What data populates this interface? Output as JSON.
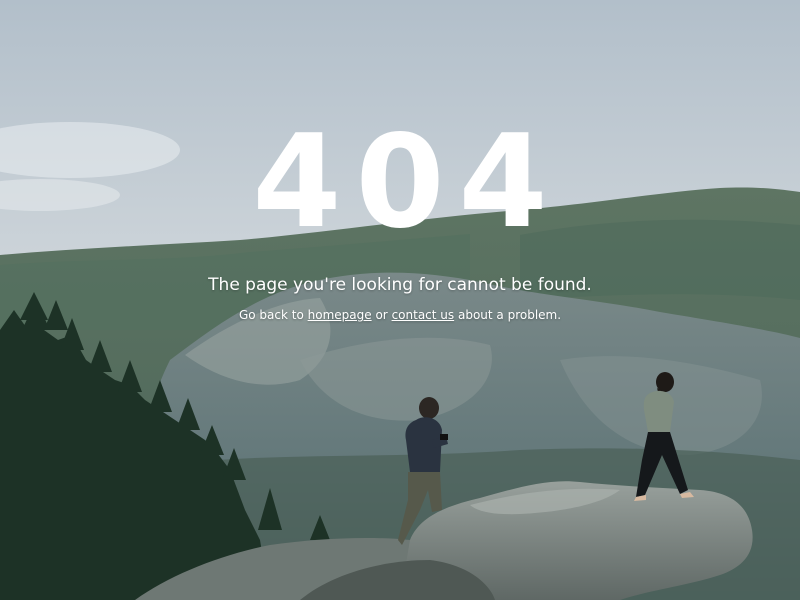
{
  "error": {
    "code": "404",
    "headline": "The page you're looking for cannot be found.",
    "help": {
      "prefix": "Go back to",
      "homepage_link": "homepage",
      "middle": "or",
      "contact_link": "contact us",
      "suffix": "about a problem."
    }
  },
  "background": {
    "sky_color": "#c9d2d9",
    "mountain_color": "#5d7273",
    "forest_color": "#1f3329",
    "rock_color": "#7f8784"
  }
}
